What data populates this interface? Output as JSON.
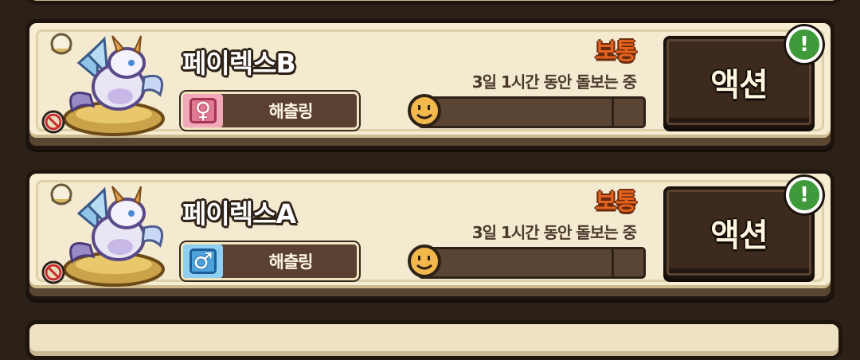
{
  "pets": [
    {
      "name": "페이렉스B",
      "gender": "female",
      "gender_glyph": "♀",
      "trait": "해츨링",
      "condition": "보통",
      "care_time": "3일 1시간 동안 돌보는 중",
      "gauge_level": 0.04,
      "action_label": "액션",
      "alert_glyph": "!"
    },
    {
      "name": "페이렉스A",
      "gender": "male",
      "gender_glyph": "♂",
      "trait": "해츨링",
      "condition": "보통",
      "care_time": "3일 1시간 동안 돌보는 중",
      "gauge_level": 0.04,
      "action_label": "액션",
      "alert_glyph": "!"
    }
  ],
  "colors": {
    "condition": "#e5631d",
    "gauge_fill": "#e8742a",
    "alert_badge": "#3e9a3a",
    "female": "#e07a93",
    "male": "#4da2dc"
  },
  "icons": {
    "portrait": "dragon-pet-sprite",
    "status_badge": "no-entry-icon",
    "egg": "egg-icon",
    "gauge_face": "smiley-face-icon",
    "alert": "exclamation-icon"
  }
}
